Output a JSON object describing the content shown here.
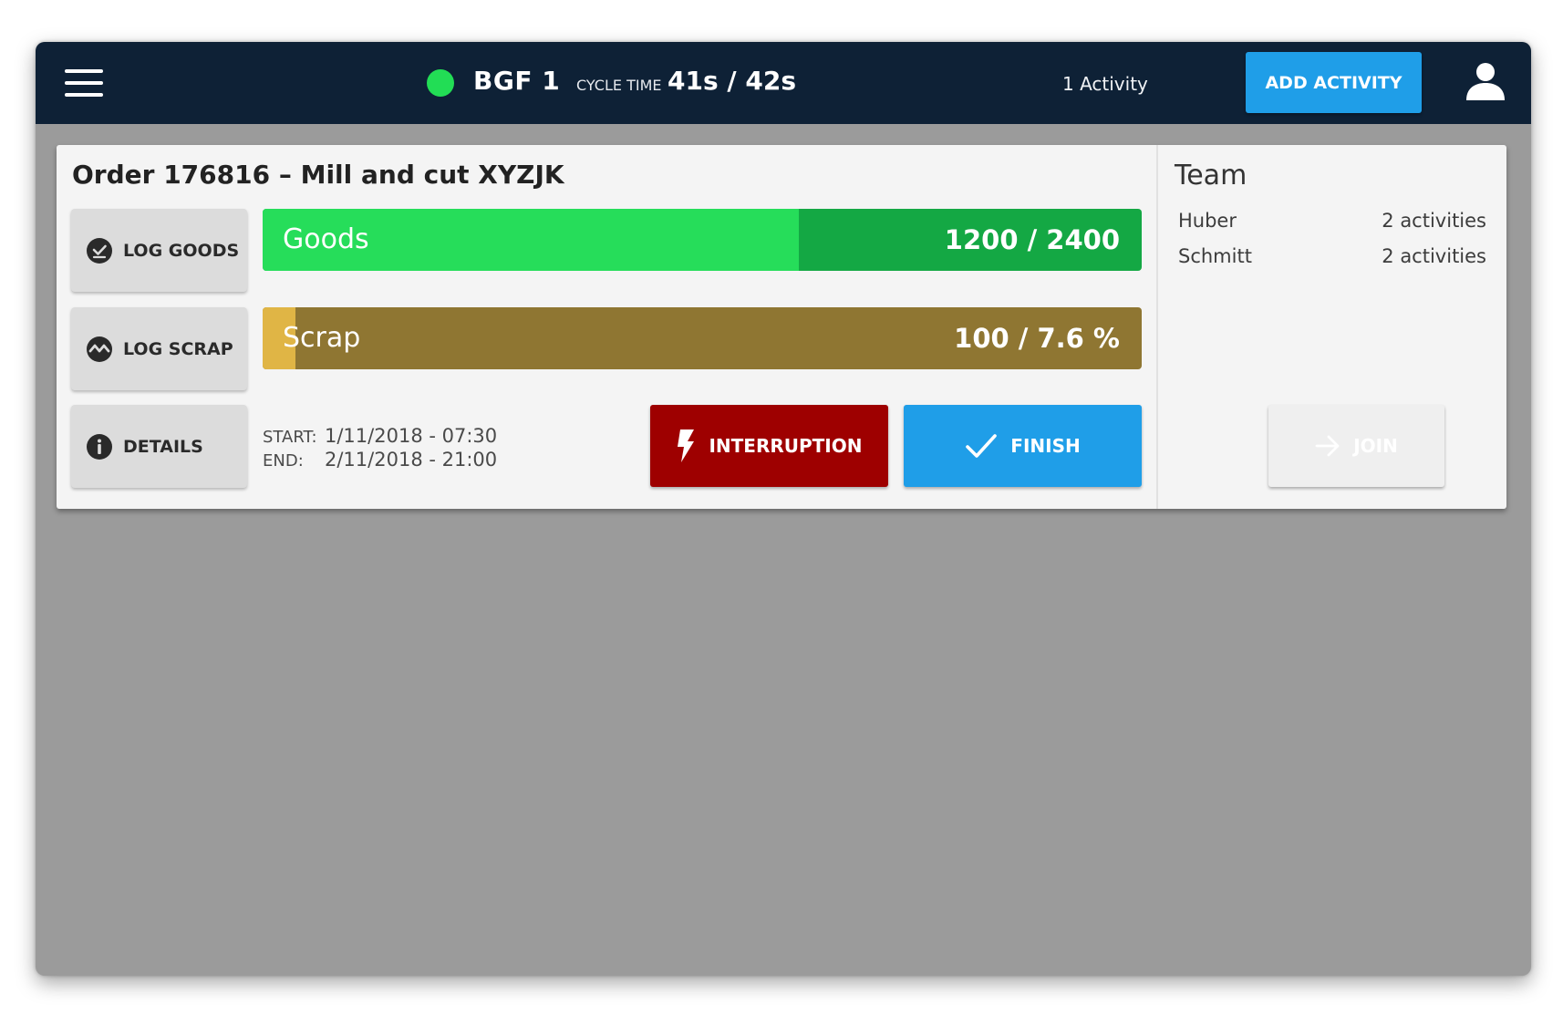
{
  "header": {
    "machine_name": "BGF 1",
    "status_color": "#22dd55",
    "cycle_time_label": "CYCLE TIME",
    "cycle_time_value": "41s / 42s",
    "activity_count": "1 Activity",
    "add_activity_label": "ADD ACTIVITY"
  },
  "order": {
    "title": "Order 176816 – Mill and cut XYZJK",
    "actions": {
      "log_goods": "LOG GOODS",
      "log_scrap": "LOG SCRAP",
      "details": "DETAILS"
    },
    "goods": {
      "label": "Goods",
      "value_text": "1200 / 2400",
      "current": 1200,
      "target": 2400,
      "fill_fraction": 0.61,
      "fill_color": "#26dd5a",
      "track_color": "#14a844"
    },
    "scrap": {
      "label": "Scrap",
      "value_text": "100 / 7.6 %",
      "fill_fraction": 0.037,
      "fill_color": "#e0b545",
      "track_color": "#8f7632"
    },
    "start_label": "START:",
    "start_value": "1/11/2018 - 07:30",
    "end_label": "END:",
    "end_value": "2/11/2018 - 21:00",
    "interruption_label": "INTERRUPTION",
    "finish_label": "FINISH"
  },
  "team": {
    "title": "Team",
    "members": [
      {
        "name": "Huber",
        "activities": "2 activities"
      },
      {
        "name": "Schmitt",
        "activities": "2 activities"
      }
    ],
    "join_label": "JOIN"
  },
  "icons": {
    "menu": "hamburger-menu-icon",
    "user": "user-icon",
    "log_goods": "check-circle-icon",
    "log_scrap": "zigzag-circle-icon",
    "details": "info-icon",
    "interruption": "lightning-icon",
    "finish": "checkmark-icon",
    "join": "arrow-right-icon"
  }
}
